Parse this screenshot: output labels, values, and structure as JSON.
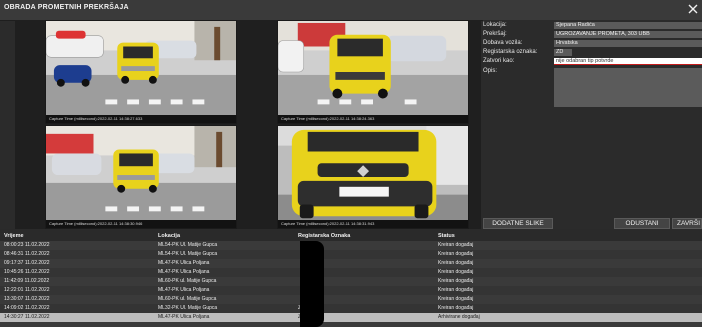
{
  "window": {
    "title": "OBRADA PROMETNIH PREKRŠAJA"
  },
  "images": {
    "captions": [
      "Capture Time (millisecond):2022-02-11 14:38:27.633",
      "Capture Time (millisecond):2022-02-11 14:38:24.363",
      "Capture Time (millisecond):2022-02-11 14:38:30.946",
      "Capture Time (millisecond):2022-02-11 14:38:31.943"
    ]
  },
  "form": {
    "lokacija": {
      "label": "Lokacija:",
      "value": "Sjepana Radića"
    },
    "prekrsaj": {
      "label": "Prekršaj:",
      "value": "UGROŽAVANJE PROMETA, 303 UBB"
    },
    "dobavljac": {
      "label": "Dobava vozila:",
      "value": "Hrvatska"
    },
    "registracija": {
      "label": "Registarska oznaka:",
      "value": "ZD"
    },
    "razlog": {
      "label": "Zatvori kao:",
      "value": "nije odabran tip potvrde"
    },
    "opis": {
      "label": "Opis:"
    }
  },
  "buttons": {
    "dodatne": "DODATNE SLIKE",
    "odustani": "ODUSTANI",
    "zavrsi": "ZAVRŠI"
  },
  "table": {
    "headers": {
      "vrijeme": "Vrijeme",
      "lokacija": "Lokacija",
      "registracija": "Registarska Oznaka",
      "status": "Status"
    },
    "rows": [
      {
        "vrijeme": "08:00:23 11.02.2022",
        "lokacija": "ML54-PK Ul. Matije Gupca",
        "reg": "",
        "status": "Kreiran događaj"
      },
      {
        "vrijeme": "08:46:31 11.02.2022",
        "lokacija": "ML54-PK Ul. Matije Gupca",
        "reg": "",
        "status": "Kreiran događaj"
      },
      {
        "vrijeme": "09:17:37 11.02.2022",
        "lokacija": "ML47-PK Ulica Poljana",
        "reg": "",
        "status": "Kreiran događaj"
      },
      {
        "vrijeme": "10:45:26 11.02.2022",
        "lokacija": "ML47-PK Ulica Poljana",
        "reg": "",
        "status": "Kreiran događaj"
      },
      {
        "vrijeme": "11:42:09 11.02.2022",
        "lokacija": "ML60-PK ul. Matije Gupca",
        "reg": "",
        "status": "Kreiran događaj"
      },
      {
        "vrijeme": "12:22:01 11.02.2022",
        "lokacija": "ML47-PK Ulica Poljana",
        "reg": "",
        "status": "Kreiran događaj"
      },
      {
        "vrijeme": "13:30:07 11.02.2022",
        "lokacija": "ML60-PK ul. Matije Gupca",
        "reg": "",
        "status": "Kreiran događaj"
      },
      {
        "vrijeme": "14:09:02 11.02.2022",
        "lokacija": "ML32-PK Ul. Matije Gupca",
        "reg": "ZD",
        "status": "Kreiran događaj"
      },
      {
        "vrijeme": "14:30:27 11.02.2022",
        "lokacija": "ML47-PK Ulica Poljana",
        "reg": "ZD",
        "status": "Arhivirane događaj"
      }
    ]
  },
  "colors": {
    "accent_red": "#c61b1b",
    "vehicle_yellow": "#e8d21c"
  }
}
